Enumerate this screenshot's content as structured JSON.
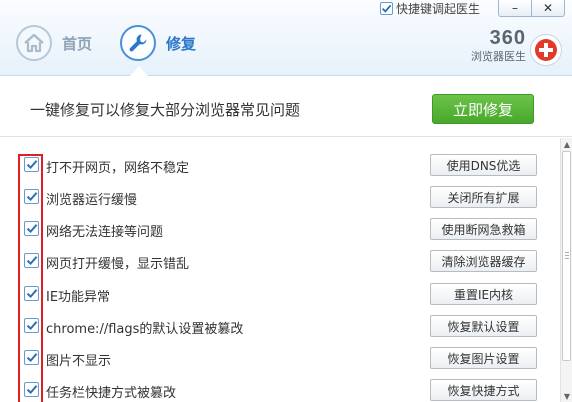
{
  "header": {
    "hotkey_checkbox": {
      "checked": true,
      "label": "快捷键调起医生"
    },
    "window_controls": {
      "minimize": "–",
      "close": "✕"
    },
    "nav": [
      {
        "label": "首页",
        "icon": "home-icon",
        "active": false
      },
      {
        "label": "修复",
        "icon": "wrench-icon",
        "active": true
      }
    ],
    "brand": {
      "name": "360",
      "subtitle": "浏览器医生",
      "icon": "medical-cross-icon"
    }
  },
  "action_bar": {
    "description": "一键修复可以修复大部分浏览器常见问题",
    "fix_button": "立即修复"
  },
  "problems": [
    {
      "checked": true,
      "label": "打不开网页，网络不稳定",
      "action": "使用DNS优选"
    },
    {
      "checked": true,
      "label": "浏览器运行缓慢",
      "action": "关闭所有扩展"
    },
    {
      "checked": true,
      "label": "网络无法连接等问题",
      "action": "使用断网急救箱"
    },
    {
      "checked": true,
      "label": "网页打开缓慢，显示错乱",
      "action": "清除浏览器缓存"
    },
    {
      "checked": true,
      "label": "IE功能异常",
      "action": "重置IE内核"
    },
    {
      "checked": true,
      "label": "chrome://flags的默认设置被篡改",
      "action": "恢复默认设置"
    },
    {
      "checked": true,
      "label": "图片不显示",
      "action": "恢复图片设置"
    },
    {
      "checked": true,
      "label": "任务栏快捷方式被篡改",
      "action": "恢复快捷方式"
    }
  ],
  "colors": {
    "accent_blue": "#2b77c9",
    "fix_green": "#48a82c",
    "highlight_red": "#e02020",
    "check_blue": "#2a6fbf"
  }
}
